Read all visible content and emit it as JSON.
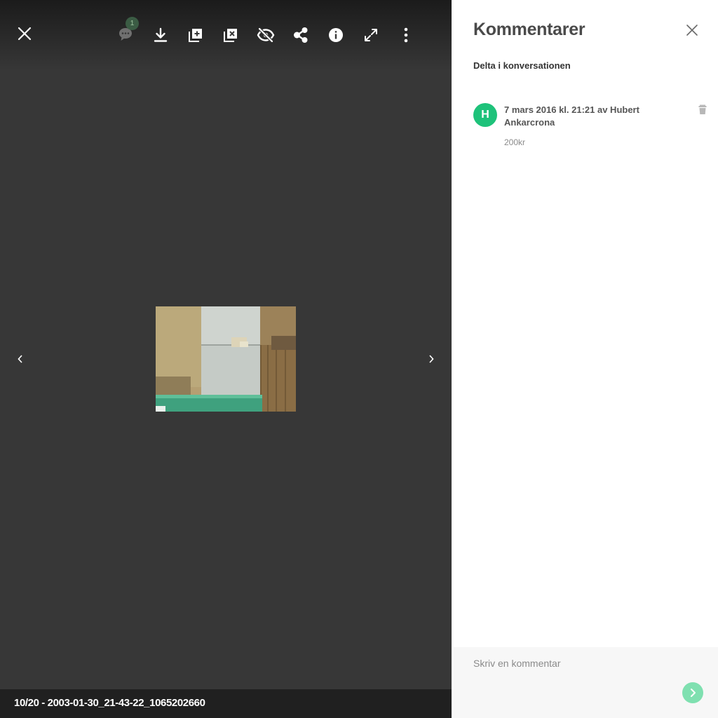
{
  "viewer": {
    "caption": "10/20 - 2003-01-30_21-43-22_1065202660",
    "comment_badge_count": "1",
    "toolbar": [
      {
        "name": "close-viewer-button",
        "icon": "close-icon"
      },
      {
        "name": "comments-button",
        "icon": "comments-icon"
      },
      {
        "name": "download-button",
        "icon": "download-icon"
      },
      {
        "name": "add-to-album-button",
        "icon": "add-to-album-icon"
      },
      {
        "name": "remove-from-album-button",
        "icon": "remove-from-album-icon"
      },
      {
        "name": "hide-button",
        "icon": "eye-off-icon"
      },
      {
        "name": "share-button",
        "icon": "share-icon"
      },
      {
        "name": "info-button",
        "icon": "info-icon"
      },
      {
        "name": "fullscreen-button",
        "icon": "expand-icon"
      },
      {
        "name": "more-button",
        "icon": "more-vertical-icon"
      }
    ]
  },
  "panel": {
    "title": "Kommentarer",
    "subtitle": "Delta i konversationen",
    "comments": [
      {
        "avatar_letter": "H",
        "meta": "7 mars 2016 kl. 21:21 av Hubert Ankarcrona",
        "text": "200kr"
      }
    ],
    "composer": {
      "placeholder": "Skriv en kommentar"
    }
  },
  "colors": {
    "viewer_bg": "#373737",
    "caption_bar": "#202020",
    "avatar": "#1ec27a",
    "send_button": "#7fe0b0",
    "badge": "#3b5c44"
  }
}
